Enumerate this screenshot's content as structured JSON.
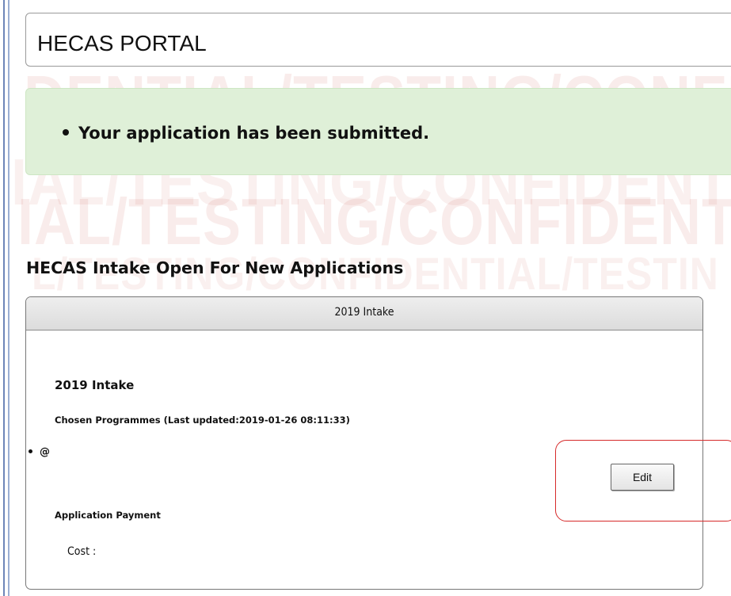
{
  "header": {
    "title": "HECAS PORTAL"
  },
  "alert": {
    "message": "Your application has been submitted."
  },
  "watermark": {
    "line1": "DENTIAL/TESTING/CONFIDENTIAL",
    "line2": "IAL/TESTING/CONFIDENTIAL/TES",
    "line3": "IAL/TESTING/CONFIDENTIAL/TES",
    "line4": "L/TESTING/CONFIDENTIAL/TESTIN"
  },
  "section": {
    "heading": "HECAS Intake Open For New Applications"
  },
  "intake": {
    "panel_title": "2019 Intake",
    "subtitle": "2019 Intake",
    "chosen_label": "Chosen Programmes (Last updated:2019-01-26 08:11:33)",
    "programmes": [
      "@"
    ],
    "edit_label": "Edit",
    "payment_label": "Application Payment",
    "cost_label": "Cost :"
  },
  "colors": {
    "alert_bg": "#dff0d8",
    "highlight": "#d62a2a",
    "watermark": "#c0392b"
  }
}
